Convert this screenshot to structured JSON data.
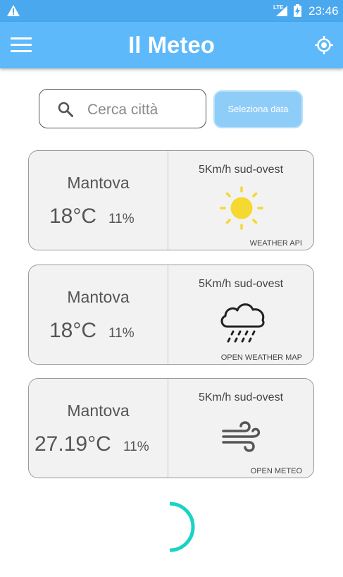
{
  "status_bar": {
    "time": "23:46",
    "network_label": "LTE"
  },
  "app_bar": {
    "title": "Il Meteo"
  },
  "search": {
    "placeholder": "Cerca città",
    "value": ""
  },
  "date_button": {
    "label": "Seleziona data"
  },
  "cards": [
    {
      "city": "Mantova",
      "temperature": "18°C",
      "humidity": "11%",
      "wind": "5Km/h sud-ovest",
      "icon": "sun-icon",
      "source": "WEATHER API"
    },
    {
      "city": "Mantova",
      "temperature": "18°C",
      "humidity": "11%",
      "wind": "5Km/h sud-ovest",
      "icon": "rain-cloud-icon",
      "source": "OPEN WEATHER MAP"
    },
    {
      "city": "Mantova",
      "temperature": "27.19°C",
      "humidity": "11%",
      "wind": "5Km/h sud-ovest",
      "icon": "wind-icon",
      "source": "OPEN METEO"
    }
  ],
  "colors": {
    "primary": "#5db9f9",
    "status_bar": "#4aa8ef",
    "date_button": "#8fcdf9",
    "sun": "#f5d930",
    "spinner": "#19d3c5",
    "card_background": "#f2f2f2"
  }
}
